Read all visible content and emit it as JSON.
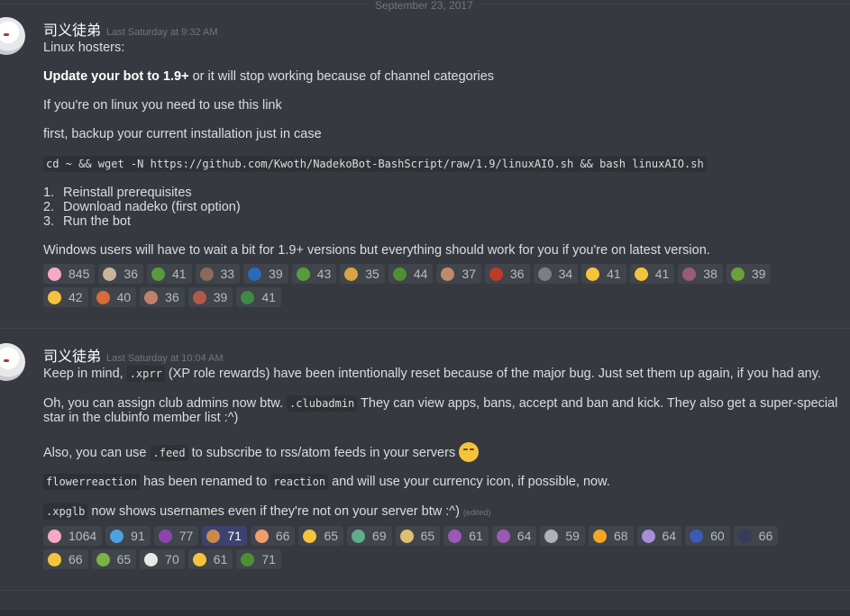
{
  "date_divider": "September 23, 2017",
  "messages": [
    {
      "username": "司义徒弟",
      "timestamp": "Last Saturday at 9:32 AM",
      "lines": {
        "l1": "Linux hosters:",
        "l2_bold": "Update your bot to 1.9+",
        "l2_rest": " or it will stop working because of channel categories",
        "l3": "If you're on linux you need to use this link",
        "l4": "first, backup your current installation just in case",
        "l5_code": "cd ~ && wget -N https://github.com/Kwoth/NadekoBot-BashScript/raw/1.9/linuxAIO.sh && bash linuxAIO.sh",
        "ol": [
          {
            "num": "1.",
            "text": "Reinstall prerequisites"
          },
          {
            "num": "2.",
            "text": "Download nadeko (first option)"
          },
          {
            "num": "3.",
            "text": "Run the bot"
          }
        ],
        "l6": "Windows users will have to wait a bit for 1.9+ versions but everything should work for you if you're on latest version."
      },
      "reactions": [
        {
          "icon": "cherry-blossom",
          "count": "845",
          "color": "#f5a9c4"
        },
        {
          "icon": "cat-face",
          "count": "36",
          "color": "#c9b39a"
        },
        {
          "icon": "pepe",
          "count": "41",
          "color": "#5a9a3d"
        },
        {
          "icon": "dab-figure",
          "count": "33",
          "color": "#8a6a5a"
        },
        {
          "icon": "sweden-flag",
          "count": "39",
          "color": "#2a6bb5"
        },
        {
          "icon": "pepe",
          "count": "43",
          "color": "#5a9a3d"
        },
        {
          "icon": "beer-mug",
          "count": "35",
          "color": "#d9a441"
        },
        {
          "icon": "pepe",
          "count": "44",
          "color": "#4f8f34"
        },
        {
          "icon": "face-portrait",
          "count": "37",
          "color": "#c08a6a"
        },
        {
          "icon": "red-hat",
          "count": "36",
          "color": "#c0392b"
        },
        {
          "icon": "anime-face",
          "count": "34",
          "color": "#7d7d8a"
        },
        {
          "icon": "thinking-face",
          "count": "41",
          "color": "#f5c33b"
        },
        {
          "icon": "smile-face",
          "count": "41",
          "color": "#f5c33b"
        },
        {
          "icon": "anime-girl",
          "count": "38",
          "color": "#9a5a7a"
        },
        {
          "icon": "pepe",
          "count": "39",
          "color": "#6aa13d"
        },
        {
          "icon": "smug-face",
          "count": "42",
          "color": "#f5c33b"
        },
        {
          "icon": "cartoon-face",
          "count": "40",
          "color": "#d96a3a"
        },
        {
          "icon": "face-portrait",
          "count": "36",
          "color": "#c0806a"
        },
        {
          "icon": "anime-face",
          "count": "39",
          "color": "#b05a4a"
        },
        {
          "icon": "pepe",
          "count": "41",
          "color": "#3f8a45"
        }
      ]
    },
    {
      "username": "司义徒弟",
      "timestamp": "Last Saturday at 10:04 AM",
      "lines": {
        "l1_a": "Keep in mind, ",
        "l1_code": ".xprr",
        "l1_b": " (XP role rewards) have been intentionally reset because of the major bug. Just set them up again, if you had any.",
        "l2_a": "Oh, you can assign club admins now btw. ",
        "l2_code": ".clubadmin",
        "l2_b": " They can view apps, bans, accept and ban and kick. They also get a super-special star in the clubinfo member list :^)",
        "l3_a": "Also, you can use ",
        "l3_code": ".feed",
        "l3_b": " to subscribe to rss/atom feeds in your servers ",
        "l4_code1": "flowerreaction",
        "l4_a": " has been renamed to ",
        "l4_code2": "reaction",
        "l4_b": " and will use your currency icon, if possible, now.",
        "l5_code": ".xpglb",
        "l5_b": " now shows usernames even if they're not on your server btw :^)",
        "edited": "(edited)"
      },
      "reactions": [
        {
          "icon": "cherry-blossom",
          "count": "1064",
          "color": "#f5a9c4",
          "me": false
        },
        {
          "icon": "sweat-drops",
          "count": "91",
          "color": "#4aa3df",
          "me": false
        },
        {
          "icon": "eggplant",
          "count": "77",
          "color": "#8e44ad",
          "me": false
        },
        {
          "icon": "cookie",
          "count": "71",
          "color": "#c98a4a",
          "me": true
        },
        {
          "icon": "peach",
          "count": "66",
          "color": "#f39c6b",
          "me": false
        },
        {
          "icon": "kissing-face",
          "count": "65",
          "color": "#f5c33b",
          "me": false
        },
        {
          "icon": "anime-face",
          "count": "69",
          "color": "#5fae8a",
          "me": false
        },
        {
          "icon": "pinwheel-face",
          "count": "65",
          "color": "#e0c070",
          "me": false
        },
        {
          "icon": "purple-hand",
          "count": "61",
          "color": "#9b59b6",
          "me": false
        },
        {
          "icon": "purple-heart",
          "count": "64",
          "color": "#9b59b6",
          "me": false
        },
        {
          "icon": "gray-icon",
          "count": "59",
          "color": "#b0b0b8",
          "me": false
        },
        {
          "icon": "laughing-face",
          "count": "68",
          "color": "#f5a623",
          "me": false
        },
        {
          "icon": "anime-face",
          "count": "64",
          "color": "#a58fd6",
          "me": false
        },
        {
          "icon": "wizard-face",
          "count": "60",
          "color": "#3b5bb5",
          "me": false
        },
        {
          "icon": "dark-figure",
          "count": "66",
          "color": "#3a3a5a",
          "me": false
        },
        {
          "icon": "smirk-face",
          "count": "66",
          "color": "#f5c33b",
          "me": false
        },
        {
          "icon": "nauseated-face",
          "count": "65",
          "color": "#7cb342",
          "me": false
        },
        {
          "icon": "eyes",
          "count": "70",
          "color": "#e8e8e8",
          "me": false
        },
        {
          "icon": "thinking-face",
          "count": "61",
          "color": "#f5c33b",
          "me": false
        },
        {
          "icon": "pepe",
          "count": "71",
          "color": "#4f8f34",
          "me": false
        }
      ]
    }
  ]
}
